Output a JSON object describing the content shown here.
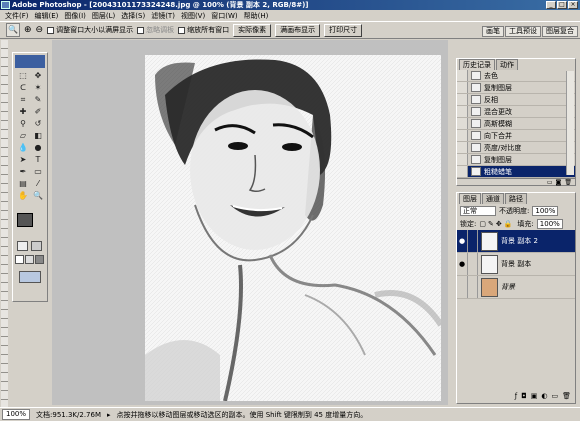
{
  "window": {
    "title": "Adobe Photoshop - [20043101173324248.jpg @ 100% (背景 副本 2, RGB/8#)]",
    "controls": [
      "_",
      "□",
      "×"
    ]
  },
  "menu": [
    "文件(F)",
    "编辑(E)",
    "图像(I)",
    "图层(L)",
    "选择(S)",
    "滤镜(T)",
    "视图(V)",
    "窗口(W)",
    "帮助(H)"
  ],
  "options": {
    "tool_icon": "🔍",
    "checkbox1": "调整窗口大小以满屏显示",
    "checkbox2": "忽略调板",
    "checkbox3": "缩放所有窗口",
    "btn_actual": "实际像素",
    "btn_fit": "满画布显示",
    "btn_print": "打印尺寸"
  },
  "well_tabs": [
    "画笔",
    "工具预设",
    "图层复合"
  ],
  "history": {
    "tabs": [
      "历史记录",
      "动作"
    ],
    "items": [
      "去色",
      "复制图层",
      "反相",
      "混合更改",
      "高斯模糊",
      "向下合并",
      "亮度/对比度",
      "复制图层",
      "粗糙蜡笔"
    ],
    "selected": 8
  },
  "layers": {
    "tabs": [
      "图层",
      "通道",
      "路径"
    ],
    "blend_mode": "正常",
    "opacity_label": "不透明度:",
    "opacity": "100%",
    "lock_label": "锁定:",
    "fill_label": "填充:",
    "fill": "100%",
    "items": [
      {
        "name": "背景 副本 2",
        "selected": true
      },
      {
        "name": "背景 副本",
        "selected": false
      },
      {
        "name": "背景",
        "selected": false
      }
    ]
  },
  "status": {
    "zoom": "100%",
    "doc": "文档:951.3K/2.76M",
    "hint": "点按并拖移以移动图层或移动选区的副本。使用 Shift 键限制到 45 度增量方向。"
  },
  "colors": {
    "titlebar": "#0a246a",
    "selection": "#0a246a",
    "panel": "#d4d0c8"
  }
}
